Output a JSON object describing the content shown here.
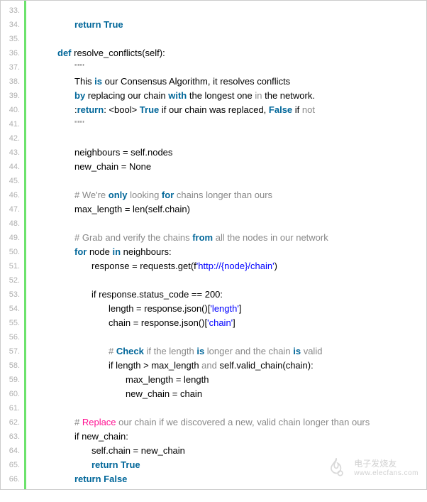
{
  "line_numbers": [
    "33.",
    "34.",
    "35.",
    "36.",
    "37.",
    "38.",
    "39.",
    "40.",
    "41.",
    "42.",
    "43.",
    "44.",
    "45.",
    "46.",
    "47.",
    "48.",
    "49.",
    "50.",
    "51.",
    "52.",
    "53.",
    "54.",
    "55.",
    "56.",
    "57.",
    "58.",
    "59.",
    "60.",
    "61.",
    "62.",
    "63.",
    "64.",
    "65.",
    "66."
  ],
  "tokens": {
    "l34": {
      "a": "return",
      "b": " True"
    },
    "l36": {
      "a": "def",
      "b": " resolve_conflicts(self):"
    },
    "l37": {
      "a": "\"\"\""
    },
    "l38": {
      "a": "This ",
      "b": "is",
      "c": " our Consensus Algorithm, it resolves conflicts"
    },
    "l39": {
      "a": "by",
      "b": " replacing our chain ",
      "c": "with",
      "d": " the longest one ",
      "e": "in",
      "f": " the network."
    },
    "l40": {
      "a": ":",
      "b": "return",
      "c": ": <bool> ",
      "d": "True",
      "e": " if our chain was replaced, ",
      "f": "False",
      "g": " if ",
      "h": "not"
    },
    "l41": {
      "a": "\"\"\""
    },
    "l43": {
      "a": "neighbours = self.nodes"
    },
    "l44": {
      "a": "new_chain = None"
    },
    "l46": {
      "a": "# We're ",
      "b": "only",
      "c": " looking ",
      "d": "for",
      "e": " chains longer than ours"
    },
    "l47": {
      "a": "max_length = len(self.chain)"
    },
    "l49": {
      "a": "# Grab ",
      "b": "and",
      "c": " verify the chains ",
      "d": "from",
      "e": " ",
      "f": "all",
      "g": " the nodes ",
      "h": "in",
      "i": " our network"
    },
    "l50": {
      "a": "for",
      "b": " node ",
      "c": "in",
      "d": " neighbours:"
    },
    "l51": {
      "a": "response = requests.get(f",
      "b": "'http://{node}/chain'",
      "c": ")"
    },
    "l53": {
      "a": "if response.status_code == 200:"
    },
    "l54": {
      "a": "length = response.json()[",
      "b": "'length'",
      "c": "]"
    },
    "l55": {
      "a": "chain = response.json()[",
      "b": "'chain'",
      "c": "]"
    },
    "l57": {
      "a": "# ",
      "b": "Check",
      "c": " if the length ",
      "d": "is",
      "e": " longer ",
      "f": "and",
      "g": " the chain ",
      "h": "is",
      "i": " valid"
    },
    "l58": {
      "a": "if length > max_length ",
      "b": "and",
      "c": " self.valid_chain(chain):"
    },
    "l59": {
      "a": "max_length = length"
    },
    "l60": {
      "a": "new_chain = chain"
    },
    "l62": {
      "a": "# ",
      "b": "Replace",
      "c": " our chain if we discovered a new, valid chain longer than ours"
    },
    "l63": {
      "a": "if new_chain:"
    },
    "l64": {
      "a": "self.chain = new_chain"
    },
    "l65": {
      "a": "return",
      "b": " True"
    },
    "l66": {
      "a": "return",
      "b": " False"
    }
  },
  "watermark": {
    "top": "电子发烧友",
    "bottom": "www.elecfans.com"
  }
}
